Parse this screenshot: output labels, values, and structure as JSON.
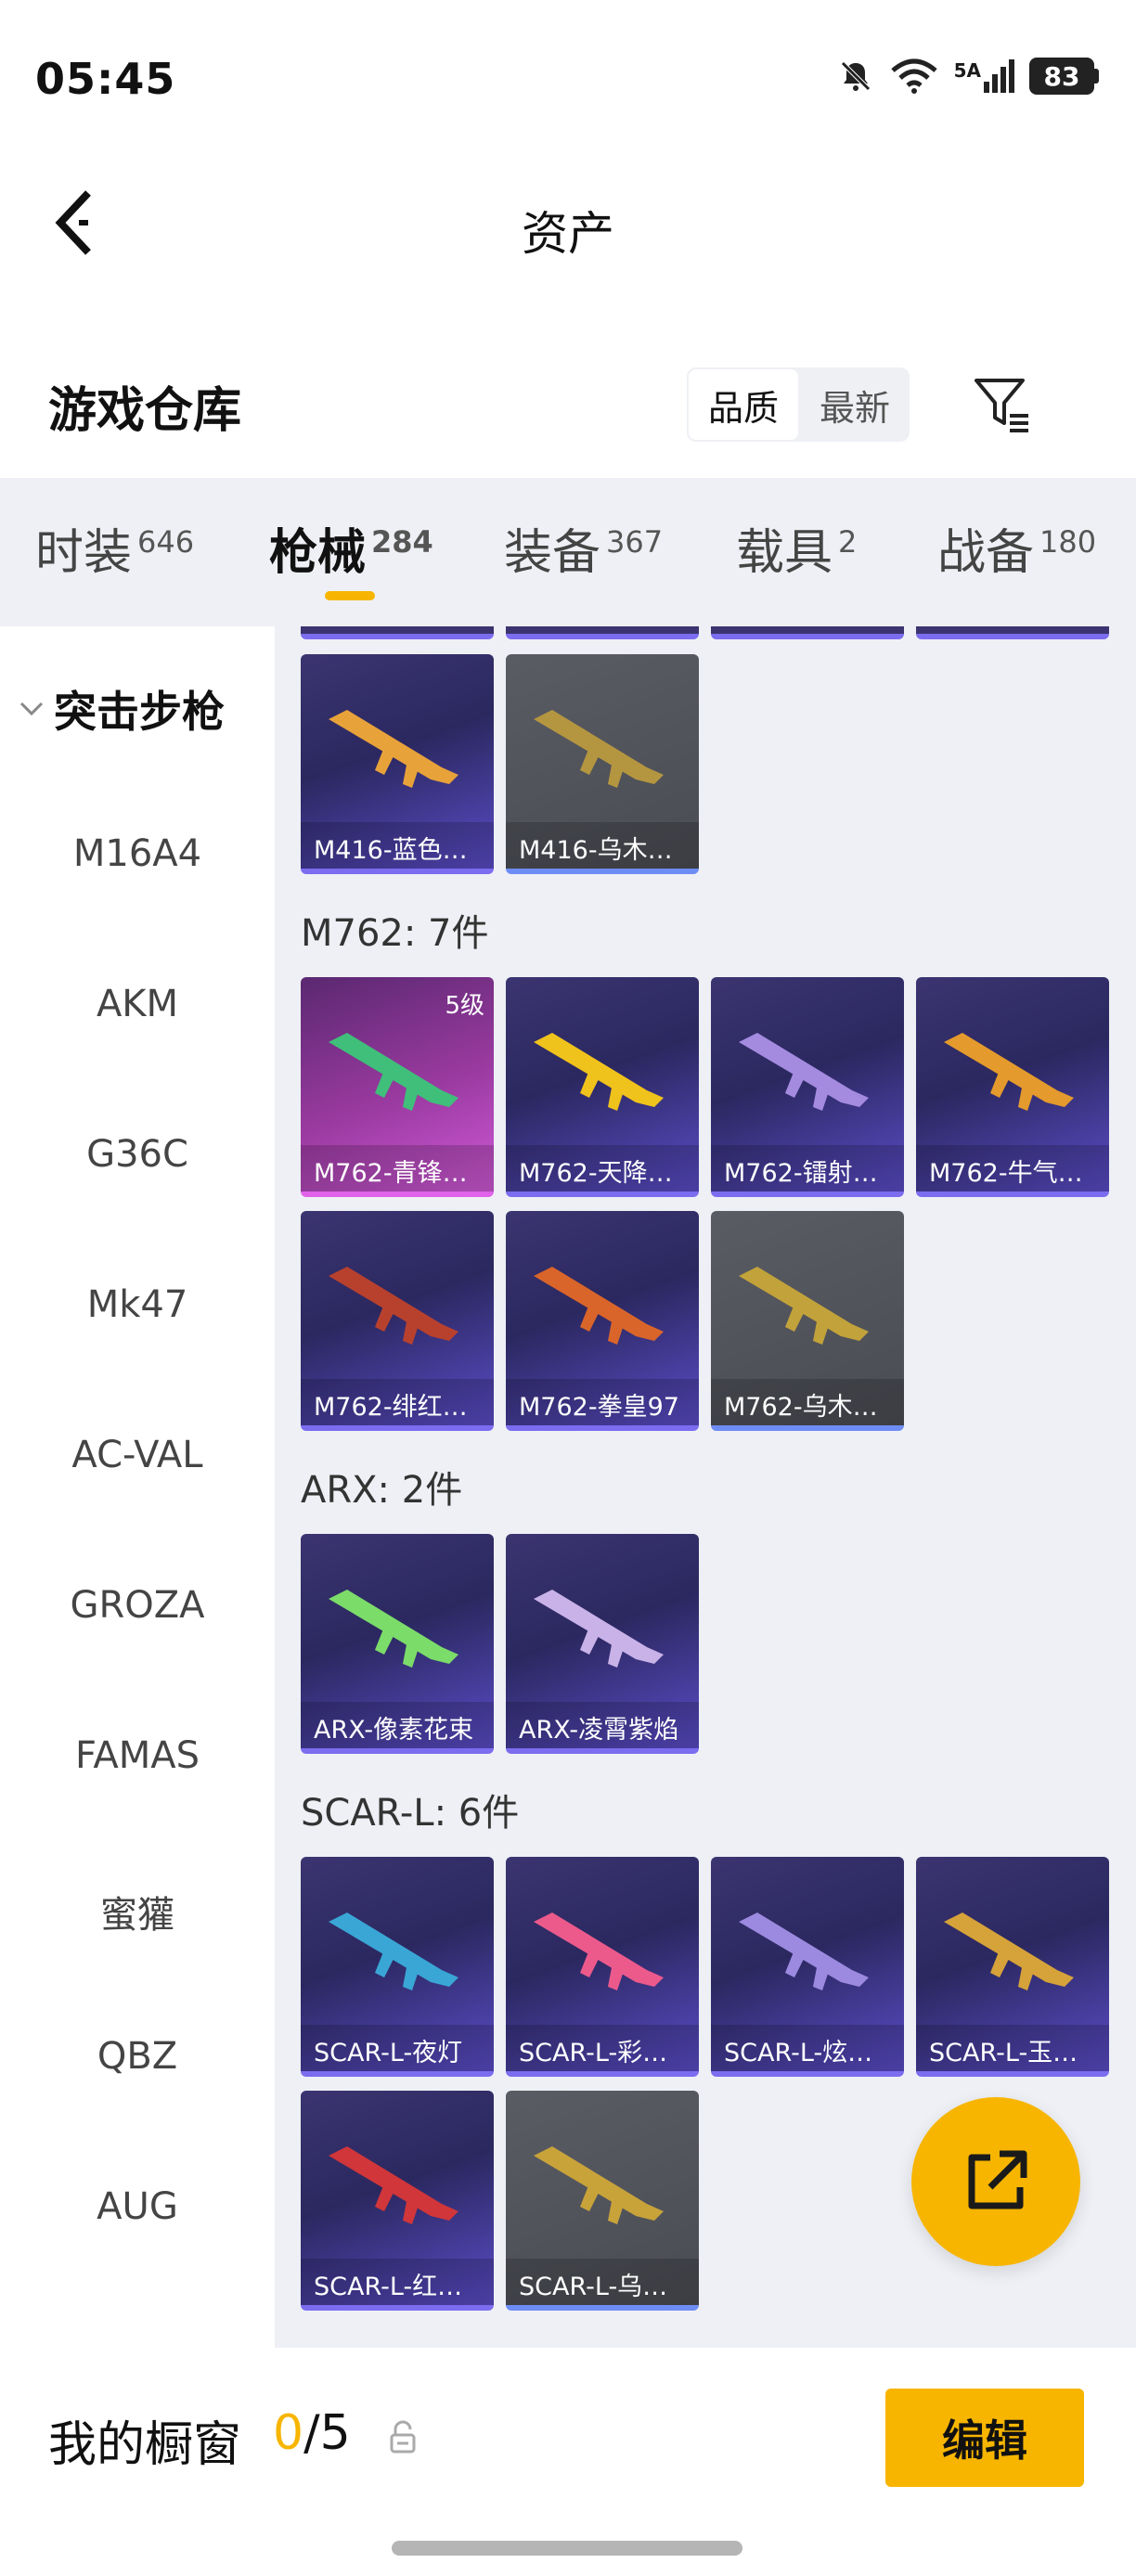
{
  "status_bar": {
    "time": "05:45",
    "network": "5A",
    "battery": "83"
  },
  "header": {
    "title": "资产"
  },
  "warehouse": {
    "title": "游戏仓库",
    "sort_options": [
      "品质",
      "最新"
    ]
  },
  "tabs": [
    {
      "label": "时装",
      "count": "646"
    },
    {
      "label": "枪械",
      "count": "284"
    },
    {
      "label": "装备",
      "count": "367"
    },
    {
      "label": "载具",
      "count": "2"
    },
    {
      "label": "战备",
      "count": "180"
    }
  ],
  "sidebar": {
    "group": "突击步枪",
    "items": [
      "M16A4",
      "AKM",
      "G36C",
      "Mk47",
      "AC-VAL",
      "GROZA",
      "FAMAS",
      "蜜獾",
      "QBZ",
      "AUG"
    ]
  },
  "sections": [
    {
      "label": "",
      "items": [
        {
          "name": "M416-蓝色…",
          "rarity": "purple",
          "gun_color": "#e8a23a"
        },
        {
          "name": "M416-乌木…",
          "rarity": "gray",
          "gun_color": "#b49640"
        }
      ]
    },
    {
      "label": "M762: 7件",
      "items": [
        {
          "name": "M762-青锋…",
          "rarity": "pink",
          "gun_color": "#3fbf7a",
          "level": "5级"
        },
        {
          "name": "M762-天降…",
          "rarity": "purple",
          "gun_color": "#f0c21c"
        },
        {
          "name": "M762-镭射…",
          "rarity": "purple",
          "gun_color": "#a48be0"
        },
        {
          "name": "M762-牛气…",
          "rarity": "purple",
          "gun_color": "#e49a2c"
        },
        {
          "name": "M762-绯红…",
          "rarity": "purple",
          "gun_color": "#b8412e"
        },
        {
          "name": "M762-拳皇97",
          "rarity": "purple",
          "gun_color": "#d9652a"
        },
        {
          "name": "M762-乌木…",
          "rarity": "gray",
          "gun_color": "#c2a23a"
        }
      ]
    },
    {
      "label": "ARX: 2件",
      "items": [
        {
          "name": "ARX-像素花束",
          "rarity": "purple",
          "gun_color": "#7cdc6a"
        },
        {
          "name": "ARX-凌霄紫焰",
          "rarity": "purple",
          "gun_color": "#c9b2e8"
        }
      ]
    },
    {
      "label": "SCAR-L: 6件",
      "items": [
        {
          "name": "SCAR-L-夜灯",
          "rarity": "purple",
          "gun_color": "#3aa6d6"
        },
        {
          "name": "SCAR-L-彩…",
          "rarity": "purple",
          "gun_color": "#ec5a8c"
        },
        {
          "name": "SCAR-L-炫…",
          "rarity": "purple",
          "gun_color": "#9c8ae0"
        },
        {
          "name": "SCAR-L-玉…",
          "rarity": "purple",
          "gun_color": "#d6a23a"
        },
        {
          "name": "SCAR-L-红…",
          "rarity": "purple",
          "gun_color": "#d0363a"
        },
        {
          "name": "SCAR-L-乌…",
          "rarity": "gray",
          "gun_color": "#c8a33a"
        }
      ]
    }
  ],
  "bottom_bar": {
    "label": "我的橱窗",
    "current": "0",
    "total": "/5",
    "edit": "编辑"
  },
  "colors": {
    "accent": "#f7b500",
    "card_purple": "#2b2860",
    "card_pink": "#9a3aa0",
    "card_gray": "#4a4c53"
  }
}
